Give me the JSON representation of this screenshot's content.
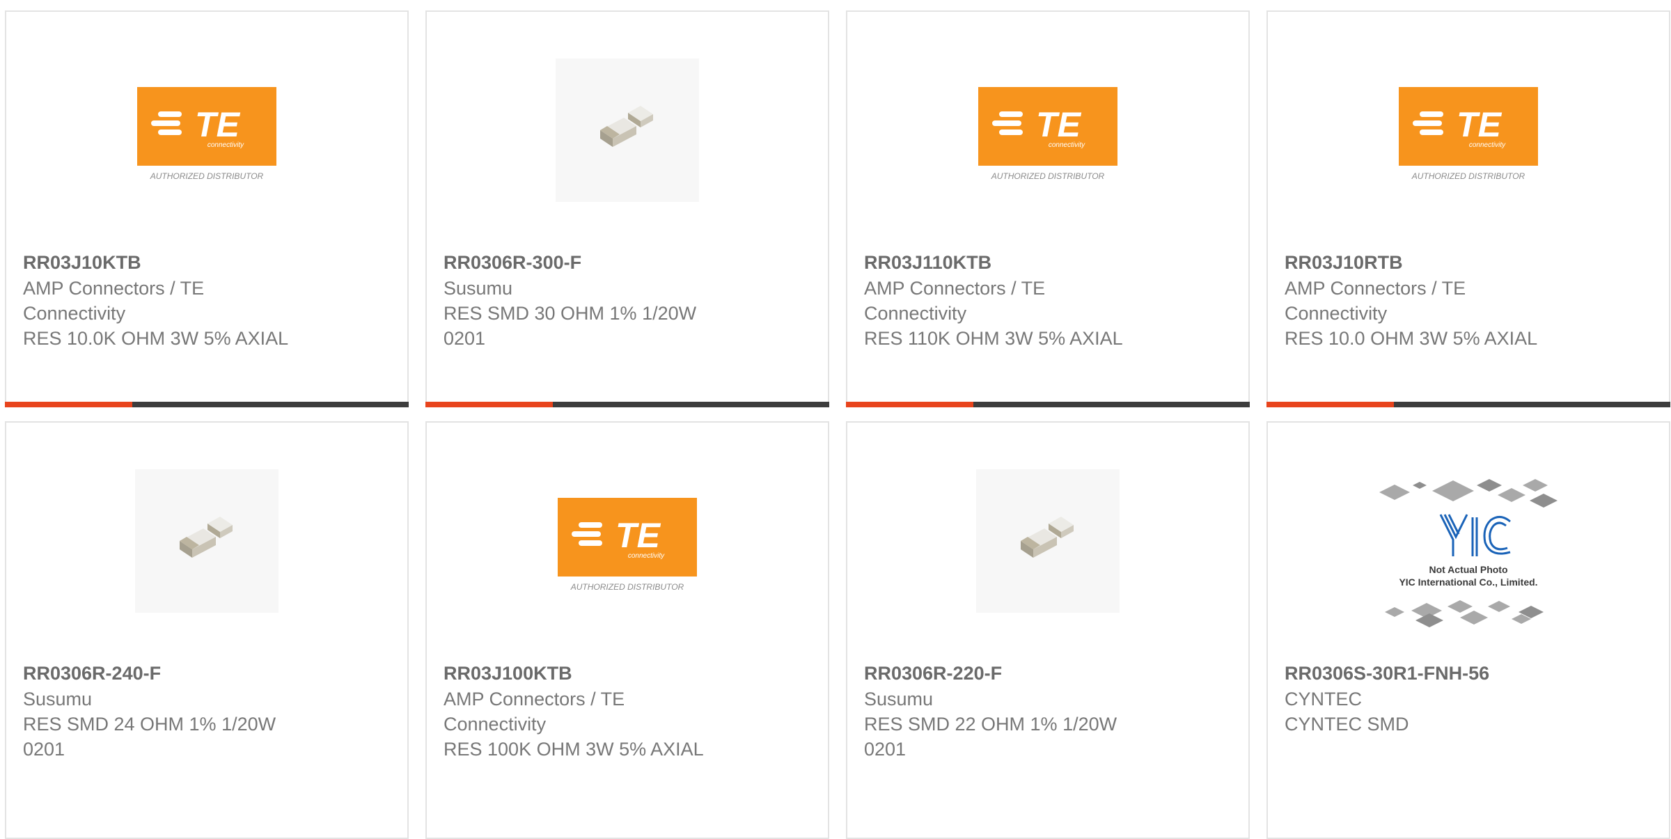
{
  "products": [
    {
      "part_number": "RR03J10KTB",
      "manufacturer": "AMP Connectors / TE Connectivity",
      "description": "RES 10.0K OHM 3W 5% AXIAL",
      "image": "te-logo",
      "logo_caption": "AUTHORIZED DISTRIBUTOR",
      "logo_sub": "connectivity",
      "logo_text": "TE",
      "bar_progress_pct": 31.5
    },
    {
      "part_number": "RR0306R-300-F",
      "manufacturer": "Susumu",
      "description": "RES SMD 30 OHM 1% 1/20W 0201",
      "image": "smd-chip-photo",
      "bar_progress_pct": 31.5
    },
    {
      "part_number": "RR03J110KTB",
      "manufacturer": "AMP Connectors / TE Connectivity",
      "description": "RES 110K OHM 3W 5% AXIAL",
      "image": "te-logo",
      "logo_caption": "AUTHORIZED DISTRIBUTOR",
      "logo_sub": "connectivity",
      "logo_text": "TE",
      "bar_progress_pct": 31.5
    },
    {
      "part_number": "RR03J10RTB",
      "manufacturer": "AMP Connectors / TE Connectivity",
      "description": "RES 10.0 OHM 3W 5% AXIAL",
      "image": "te-logo",
      "logo_caption": "AUTHORIZED DISTRIBUTOR",
      "logo_sub": "connectivity",
      "logo_text": "TE",
      "bar_progress_pct": 31.5
    },
    {
      "part_number": "RR0306R-240-F",
      "manufacturer": "Susumu",
      "description": "RES SMD 24 OHM 1% 1/20W 0201",
      "image": "smd-chip-photo"
    },
    {
      "part_number": "RR03J100KTB",
      "manufacturer": "AMP Connectors / TE Connectivity",
      "description": "RES 100K OHM 3W 5% AXIAL",
      "image": "te-logo",
      "logo_caption": "AUTHORIZED DISTRIBUTOR",
      "logo_sub": "connectivity",
      "logo_text": "TE"
    },
    {
      "part_number": "RR0306R-220-F",
      "manufacturer": "Susumu",
      "description": "RES SMD 22 OHM 1% 1/20W 0201",
      "image": "smd-chip-photo"
    },
    {
      "part_number": "RR0306S-30R1-FNH-56",
      "manufacturer": "CYNTEC",
      "description": "CYNTEC SMD",
      "image": "yic-placeholder",
      "placeholder_line1": "Not Actual Photo",
      "placeholder_line2": "YIC International Co., Limited.",
      "placeholder_logo": "YIC"
    }
  ],
  "colors": {
    "te_orange": "#f7941d",
    "progress_fill": "#e8441d",
    "progress_track": "#3d3d3d",
    "text_gray": "#777777",
    "card_border": "#e3e3e3"
  }
}
